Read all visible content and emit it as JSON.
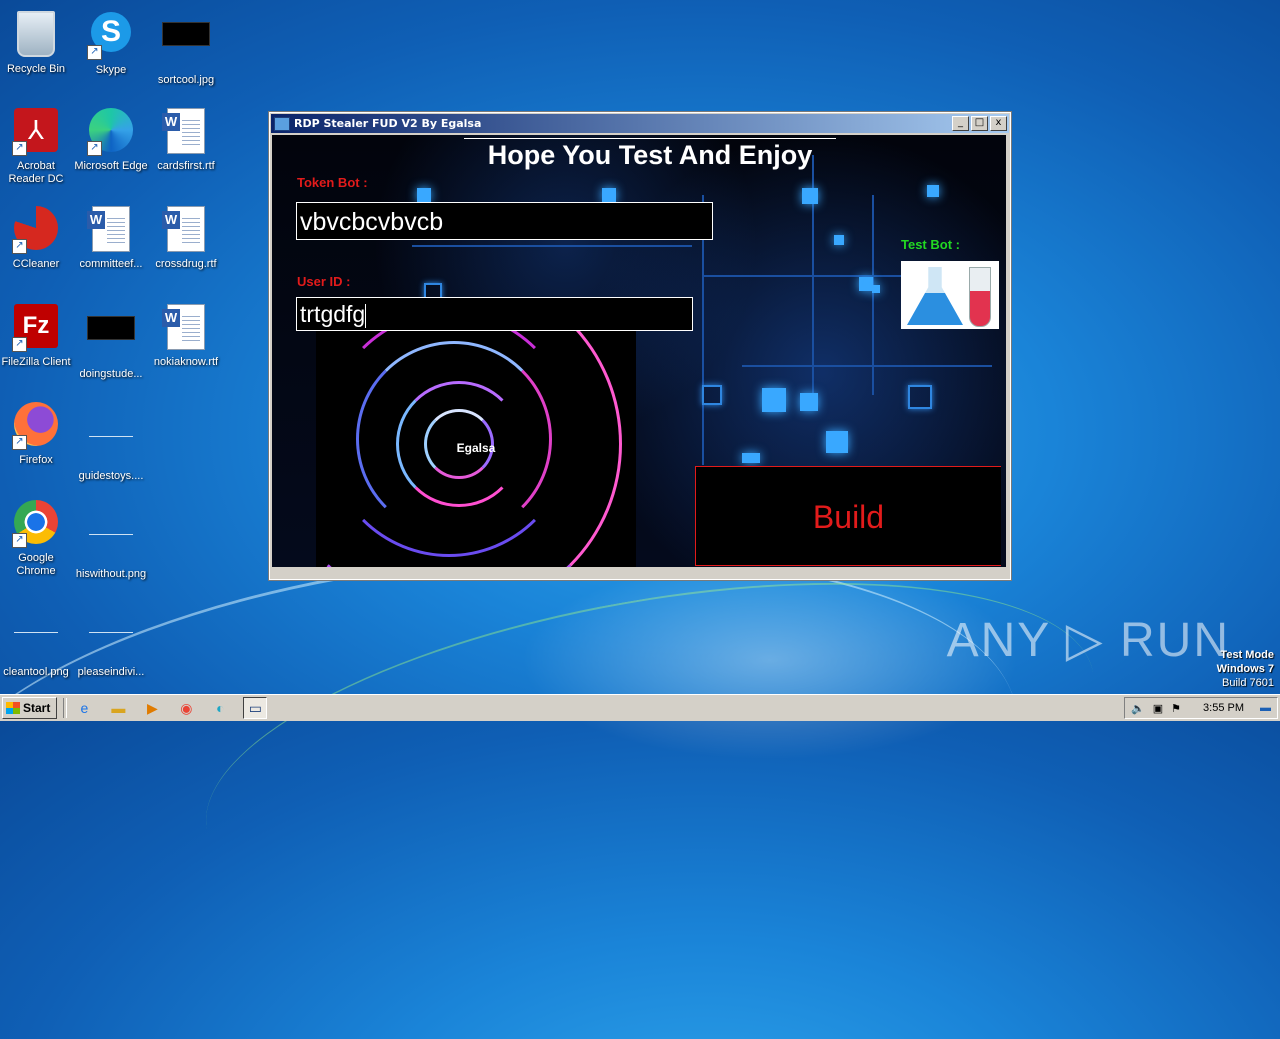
{
  "desktop": {
    "icons": [
      {
        "label": "Recycle Bin"
      },
      {
        "label": "Skype"
      },
      {
        "label": "sortcool.jpg"
      },
      {
        "label": "Acrobat Reader DC"
      },
      {
        "label": "Microsoft Edge"
      },
      {
        "label": "cardsfirst.rtf"
      },
      {
        "label": "CCleaner"
      },
      {
        "label": "committeef..."
      },
      {
        "label": "crossdrug.rtf"
      },
      {
        "label": "FileZilla Client"
      },
      {
        "label": "doingstude..."
      },
      {
        "label": "nokiaknow.rtf"
      },
      {
        "label": "Firefox"
      },
      {
        "label": "guidestoys...."
      },
      {
        "label": "Google Chrome"
      },
      {
        "label": "hiswithout.png"
      },
      {
        "label": "cleantool.png"
      },
      {
        "label": "pleaseindivi..."
      }
    ]
  },
  "window": {
    "title": "RDP Stealer FUD V2 By Egalsa",
    "minimize": "_",
    "maximize": "□",
    "close": "x",
    "headline": "Hope You Test And Enjoy",
    "token_label": "Token Bot :",
    "token_value": "vbvcbcvbvcb",
    "user_label": "User ID :",
    "user_value": "trtgdfg",
    "test_label": "Test Bot :",
    "vortex_text": "Egalsa",
    "build_label": "Build"
  },
  "taskbar": {
    "start_label": "Start",
    "clock": "3:55 PM"
  },
  "overlay": {
    "watermark": "ANY ▷ RUN",
    "testmode_line1": "Test Mode",
    "testmode_line2": "Windows 7",
    "testmode_line3": "Build 7601"
  },
  "colors": {
    "accent_red": "#e21b1b",
    "accent_green": "#22d922",
    "title_bar": "#0a246a"
  }
}
